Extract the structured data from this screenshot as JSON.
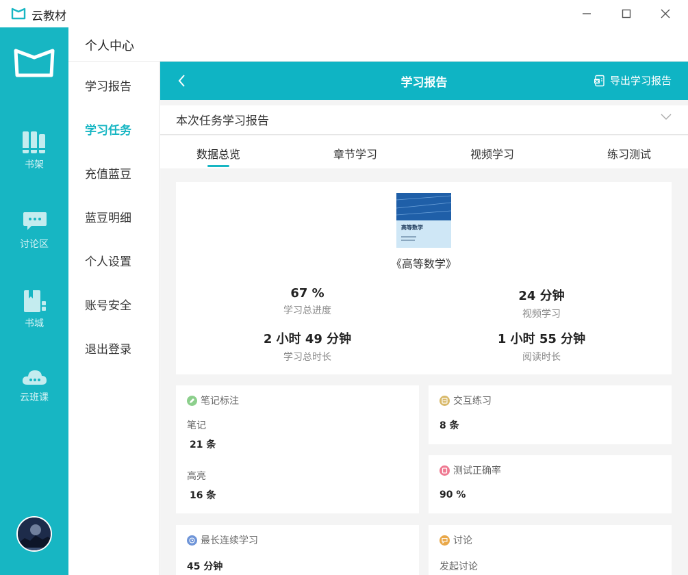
{
  "app": {
    "title": "云教材"
  },
  "rail": {
    "items": [
      {
        "label": "书架",
        "icon": "bookshelf-icon"
      },
      {
        "label": "讨论区",
        "icon": "chat-icon"
      },
      {
        "label": "书城",
        "icon": "bookstore-icon"
      },
      {
        "label": "云班课",
        "icon": "cloud-class-icon"
      }
    ]
  },
  "sidebar": {
    "header": "个人中心",
    "items": [
      {
        "label": "学习报告"
      },
      {
        "label": "学习任务"
      },
      {
        "label": "充值蓝豆"
      },
      {
        "label": "蓝豆明细"
      },
      {
        "label": "个人设置"
      },
      {
        "label": "账号安全"
      },
      {
        "label": "退出登录"
      }
    ],
    "active_index": 1
  },
  "topbar": {
    "title": "学习报告",
    "export_label": "导出学习报告"
  },
  "selector": {
    "value": "本次任务学习报告"
  },
  "tabs": [
    {
      "label": "数据总览"
    },
    {
      "label": "章节学习"
    },
    {
      "label": "视频学习"
    },
    {
      "label": "练习测试"
    }
  ],
  "overview": {
    "book_cover_title": "高等数学",
    "book_name": "《高等数学》",
    "stats": [
      {
        "value": "67 %",
        "label": "学习总进度"
      },
      {
        "value": "24 分钟",
        "label": "视频学习"
      },
      {
        "value": "2 小时 49 分钟",
        "label": "学习总时长"
      },
      {
        "value": "1 小时 55 分钟",
        "label": "阅读时长"
      }
    ]
  },
  "notes": {
    "title": "笔记标注",
    "note_label": "笔记",
    "note_value": "21 条",
    "highlight_label": "高亮",
    "highlight_value": "16 条"
  },
  "interact": {
    "title": "交互练习",
    "value": "8 条"
  },
  "correct": {
    "title": "测试正确率",
    "value": "90 %"
  },
  "streak": {
    "title": "最长连续学习",
    "value": "45 分钟"
  },
  "discuss": {
    "title": "讨论",
    "label": "发起讨论"
  },
  "colors": {
    "accent": "#17b6c3",
    "topbar": "#0fb4c4",
    "green": "#8ccf8c",
    "gold": "#d8b96a",
    "pink": "#ef7a92",
    "blue": "#6f95d8",
    "orange": "#e9a84a"
  }
}
